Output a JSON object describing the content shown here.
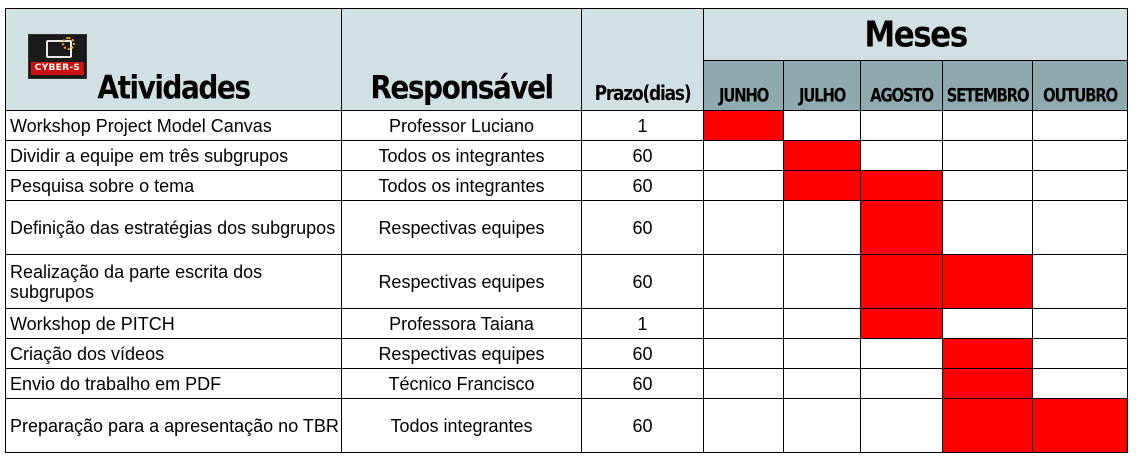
{
  "logo": {
    "text": "CYBER-S"
  },
  "headers": {
    "activities": "Atividades",
    "responsible": "Responsável",
    "deadline": "Prazo(dias)",
    "months_title": "Meses"
  },
  "months": [
    "JUNHO",
    "JULHO",
    "AGOSTO",
    "SETEMBRO",
    "OUTUBRO"
  ],
  "colors": {
    "header_bg": "#d0e0e3",
    "month_bg": "#8eaaae",
    "fill": "#ff0000"
  },
  "rows": [
    {
      "activity": "Workshop Project Model Canvas",
      "responsible": "Professor Luciano",
      "days": "1",
      "months": [
        true,
        false,
        false,
        false,
        false
      ]
    },
    {
      "activity": "Dividir a equipe em três subgrupos",
      "responsible": "Todos os integrantes",
      "days": "60",
      "months": [
        false,
        true,
        false,
        false,
        false
      ]
    },
    {
      "activity": "Pesquisa sobre o tema",
      "responsible": "Todos os integrantes",
      "days": "60",
      "months": [
        false,
        true,
        true,
        false,
        false
      ]
    },
    {
      "activity": "Definição das estratégias dos subgrupos",
      "responsible": "Respectivas equipes",
      "days": "60",
      "months": [
        false,
        false,
        true,
        false,
        false
      ]
    },
    {
      "activity": "Realização da parte escrita dos subgrupos",
      "responsible": "Respectivas equipes",
      "days": "60",
      "months": [
        false,
        false,
        true,
        true,
        false
      ]
    },
    {
      "activity": "Workshop de PITCH",
      "responsible": "Professora Taiana",
      "days": "1",
      "months": [
        false,
        false,
        true,
        false,
        false
      ]
    },
    {
      "activity": "Criação dos vídeos",
      "responsible": "Respectivas equipes",
      "days": "60",
      "months": [
        false,
        false,
        false,
        true,
        false
      ]
    },
    {
      "activity": "Envio do trabalho em PDF",
      "responsible": "Técnico Francisco",
      "days": "60",
      "months": [
        false,
        false,
        false,
        true,
        false
      ]
    },
    {
      "activity": "Preparação para a apresentação no TBR",
      "responsible": "Todos integrantes",
      "days": "60",
      "months": [
        false,
        false,
        false,
        true,
        true
      ]
    }
  ]
}
